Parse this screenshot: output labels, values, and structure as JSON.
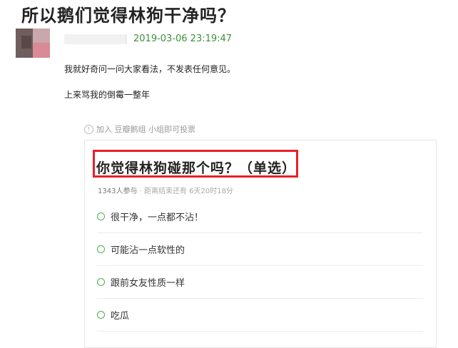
{
  "post": {
    "title": "所以鹅们觉得林狗干净吗？",
    "timestamp": "2019-03-06 23:19:47",
    "paragraph1": "我就好奇问一问大家看法，不发表任何意见。",
    "paragraph2": "上来骂我的倒霉一整年"
  },
  "poll": {
    "join_notice": "加入 豆瓣鹅组 小组即可投票",
    "info_icon": "info-icon",
    "question": "你觉得林狗碰那个吗？（单选）",
    "participants": "1343人参与",
    "remaining": " · 距离结束还有 6天20时18分",
    "options": [
      {
        "label": "很干净，一点都不沾！"
      },
      {
        "label": "可能沾一点软性的"
      },
      {
        "label": "跟前女友性质一样"
      },
      {
        "label": "吃瓜"
      }
    ],
    "highlight_color": "#e8202a",
    "accent_color": "#4caf50"
  }
}
